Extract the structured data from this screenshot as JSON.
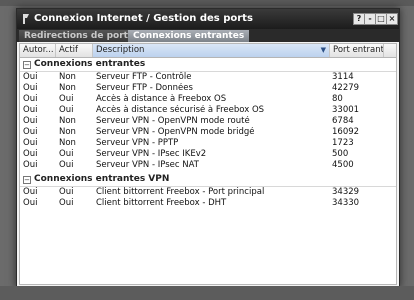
{
  "window": {
    "title": "Connexion Internet / Gestion des ports"
  },
  "titlebar_buttons": [
    "?",
    "-",
    "□",
    "×"
  ],
  "tabs": [
    "Redirections de ports",
    "Connexions entrantes"
  ],
  "columns": [
    "Autor...",
    "Actif",
    "Description",
    "Port entrant"
  ],
  "groups": [
    {
      "label": "Connexions entrantes",
      "rows": [
        {
          "autorise": "Oui",
          "actif": "Non",
          "description": "Serveur FTP - Contrôle",
          "port": "3114"
        },
        {
          "autorise": "Oui",
          "actif": "Non",
          "description": "Serveur FTP - Données",
          "port": "42279"
        },
        {
          "autorise": "Oui",
          "actif": "Oui",
          "description": "Accès à distance à Freebox OS",
          "port": "80"
        },
        {
          "autorise": "Oui",
          "actif": "Oui",
          "description": "Accès à distance sécurisé à Freebox OS",
          "port": "33001"
        },
        {
          "autorise": "Oui",
          "actif": "Non",
          "description": "Serveur VPN - OpenVPN mode routé",
          "port": "6784"
        },
        {
          "autorise": "Oui",
          "actif": "Non",
          "description": "Serveur VPN - OpenVPN mode bridgé",
          "port": "16092"
        },
        {
          "autorise": "Oui",
          "actif": "Non",
          "description": "Serveur VPN - PPTP",
          "port": "1723"
        },
        {
          "autorise": "Oui",
          "actif": "Oui",
          "description": "Serveur VPN - IPsec IKEv2",
          "port": "500"
        },
        {
          "autorise": "Oui",
          "actif": "Oui",
          "description": "Serveur VPN - IPsec NAT",
          "port": "4500"
        }
      ]
    },
    {
      "label": "Connexions entrantes VPN",
      "rows": [
        {
          "autorise": "Oui",
          "actif": "Oui",
          "description": "Client bittorrent Freebox - Port principal",
          "port": "34329"
        },
        {
          "autorise": "Oui",
          "actif": "Oui",
          "description": "Client bittorrent Freebox - DHT",
          "port": "34330"
        }
      ]
    }
  ]
}
